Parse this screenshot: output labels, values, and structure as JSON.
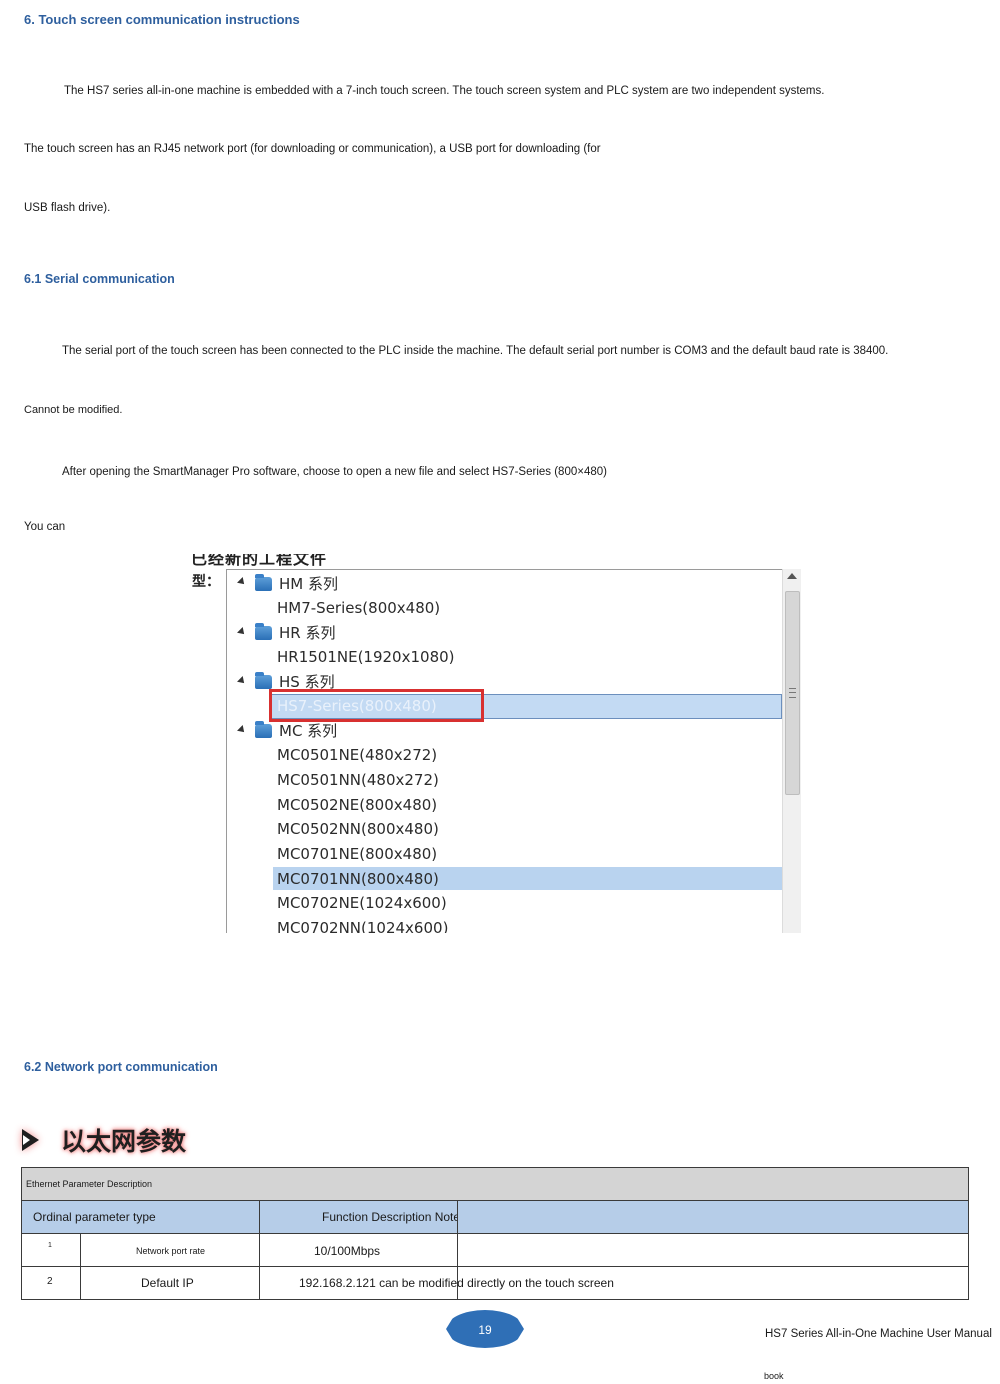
{
  "section6": {
    "title": "6. Touch screen communication instructions",
    "para1_line1": "The HS7 series all-in-one machine is embedded with a 7-inch touch screen. The touch screen system and PLC system are two independent systems.",
    "para1_line2": "The touch screen has an RJ45 network port (for downloading or communication), a USB port for downloading (for",
    "para1_line3": "USB flash drive)."
  },
  "section61": {
    "title": "6.1 Serial communication",
    "para1_line1": "The serial port of the touch screen has been connected to the PLC inside the machine. The default serial port number is COM3 and the default baud rate is 38400.",
    "para1_line2": "Cannot be modified.",
    "para2_line1": "After opening the SmartManager Pro software, choose to open a new file and select HS7-Series (800×480)",
    "para2_line2": "You can"
  },
  "screenshot": {
    "cut_title": "已经新的工程文件",
    "type_label": "型：",
    "groups": [
      {
        "label": "HM 系列",
        "items": [
          "HM7-Series(800x480)"
        ]
      },
      {
        "label": "HR 系列",
        "items": [
          "HR1501NE(1920x1080)"
        ]
      },
      {
        "label": "HS 系列",
        "items": [
          "HS7-Series(800x480)"
        ]
      },
      {
        "label": "MC 系列",
        "items": [
          "MC0501NE(480x272)",
          "MC0501NN(480x272)",
          "MC0502NE(800x480)",
          "MC0502NN(800x480)",
          "MC0701NE(800x480)",
          "MC0701NN(800x480)",
          "MC0702NE(1024x600)",
          "MC0702NN(1024x600)"
        ]
      }
    ],
    "selected_item": "HS7-Series(800x480)",
    "highlighted_item": "MC0701NN(800x480)"
  },
  "section62": {
    "title": "6.2 Network port communication",
    "cn_heading": "以太网参数"
  },
  "table": {
    "caption": "Ethernet Parameter Description",
    "headers": {
      "col1": "Ordinal parameter type",
      "col2": "Function Description Notes"
    },
    "rows": [
      {
        "ordinal": "1",
        "param": "Network port rate",
        "desc": "10/100Mbps"
      },
      {
        "ordinal": "2",
        "param": "Default IP",
        "desc": "192.168.2.121 can be modified directly on the touch screen"
      }
    ]
  },
  "footer": {
    "page_number": "19",
    "manual_title": "HS7 Series All-in-One Machine User Manual",
    "manual_title_cont": "book"
  },
  "colors": {
    "heading_blue": "#2e5f9e",
    "table_header": "#b6cde8",
    "selection": "#b9d3ef",
    "red_box": "#d83030",
    "badge": "#2f6fb6"
  }
}
